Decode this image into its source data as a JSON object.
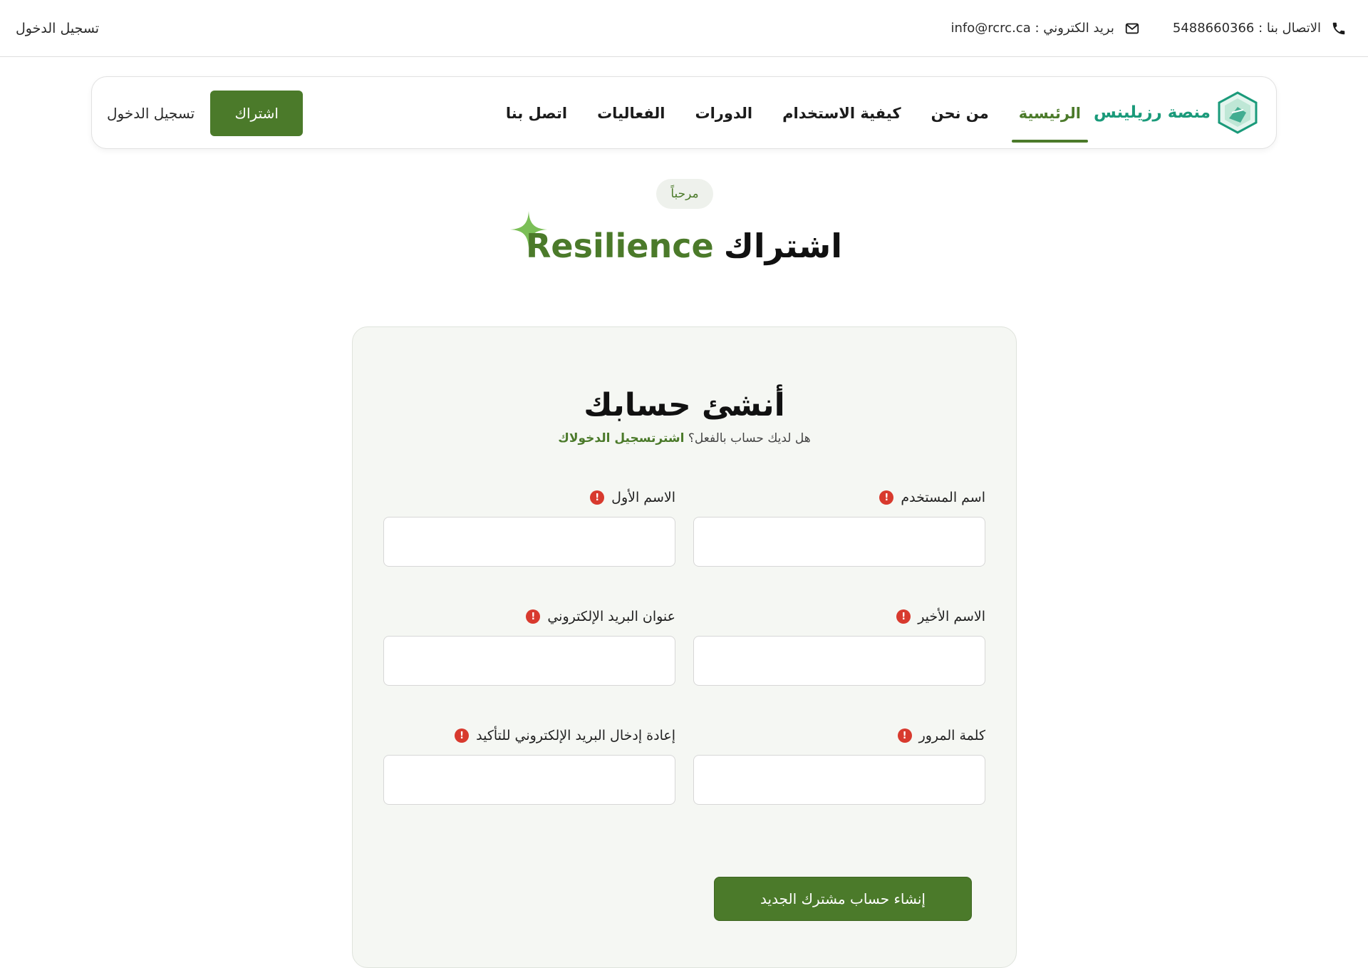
{
  "topbar": {
    "phone": "الاتصال بنا : 5488660366",
    "email": "بريد الكتروني : info@rcrc.ca",
    "login": "تسجيل الدخول"
  },
  "nav": {
    "logo_text": "منصة رزيلينس",
    "items": [
      {
        "label": "الرئيسية",
        "active": true
      },
      {
        "label": "من نحن"
      },
      {
        "label": "كيفية الاستخدام"
      },
      {
        "label": "الدورات"
      },
      {
        "label": "الفعاليات"
      },
      {
        "label": "اتصل بنا"
      }
    ],
    "login": "تسجيل الدخول",
    "subscribe": "اشتراك"
  },
  "hero": {
    "badge": "مرحباً",
    "title_ar": "اشتراك",
    "title_en": "Resilience"
  },
  "form": {
    "title": "أنشئ حسابك",
    "subtitle": "هل لديك حساب بالفعل؟",
    "subtitle_link": "اشترتسجيل الدخولاك",
    "fields": {
      "username": "اسم المستخدم",
      "first_name": "الاسم الأول",
      "last_name": "الاسم الأخير",
      "email": "عنوان البريد الإلكتروني",
      "password": "كلمة المرور",
      "email_confirm": "إعادة إدخال البريد الإلكتروني للتأكيد"
    },
    "required_mark": "!",
    "submit": "إنشاء حساب مشترك الجديد"
  },
  "colors": {
    "accent": "#4b7a2a",
    "brand_teal": "#1a9a7a",
    "required": "#d83a2e"
  }
}
